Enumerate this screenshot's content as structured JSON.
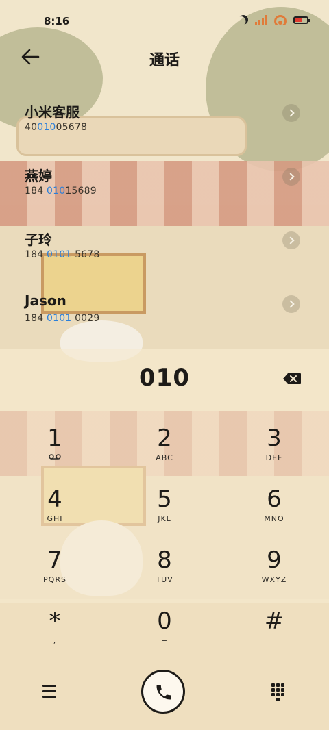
{
  "status_bar": {
    "time": "8:16",
    "icons": [
      "moon-icon",
      "signal-icon",
      "wifi-icon",
      "battery-icon"
    ],
    "battery_level": 0.55,
    "accent_color": "#e07b39"
  },
  "header": {
    "back_icon": "arrow-left-icon",
    "title": "通话"
  },
  "contacts": [
    {
      "name": "小米客服",
      "number_pre": "40",
      "number_match": "010",
      "number_post": "05678"
    },
    {
      "name": "燕婷",
      "number_pre": "184 ",
      "number_match": "010",
      "number_post": "15689"
    },
    {
      "name": "子玲",
      "number_pre": "184 ",
      "number_match": "0101",
      "number_post": " 5678"
    },
    {
      "name": "Jason",
      "number_pre": "184 ",
      "number_match": "0101",
      "number_post": " 0029"
    }
  ],
  "highlight_color": "#2b7fd9",
  "dial": {
    "entered": "010",
    "backspace_icon": "backspace-icon"
  },
  "keypad": [
    {
      "digit": "1",
      "letters": "voicemail-icon"
    },
    {
      "digit": "2",
      "letters": "ABC"
    },
    {
      "digit": "3",
      "letters": "DEF"
    },
    {
      "digit": "4",
      "letters": "GHI"
    },
    {
      "digit": "5",
      "letters": "JKL"
    },
    {
      "digit": "6",
      "letters": "MNO"
    },
    {
      "digit": "7",
      "letters": "PQRS"
    },
    {
      "digit": "8",
      "letters": "TUV"
    },
    {
      "digit": "9",
      "letters": "WXYZ"
    },
    {
      "digit": "*",
      "letters": ","
    },
    {
      "digit": "0",
      "letters": "+"
    },
    {
      "digit": "#",
      "letters": ""
    }
  ],
  "bottom_bar": {
    "menu_icon": "menu-icon",
    "call_icon": "phone-icon",
    "dialpad_icon": "dialpad-icon"
  }
}
